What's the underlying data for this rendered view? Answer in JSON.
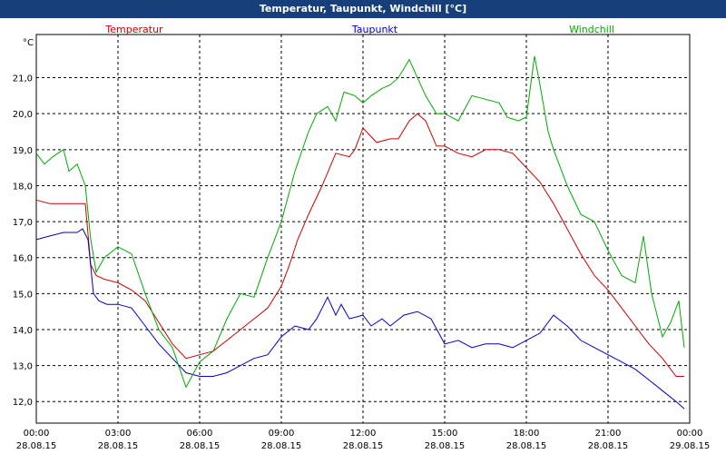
{
  "window": {
    "title": "Temperatur, Taupunkt, Windchill [°C]"
  },
  "chart_data": {
    "type": "line",
    "title": "Temperatur, Taupunkt, Windchill [°C]",
    "ylabel": "°C",
    "ylim": [
      11.4,
      22.2
    ],
    "xlim": [
      0,
      24
    ],
    "yticks": [
      "12,0",
      "13,0",
      "14,0",
      "15,0",
      "16,0",
      "17,0",
      "18,0",
      "19,0",
      "20,0",
      "21,0"
    ],
    "ytick_values": [
      12,
      13,
      14,
      15,
      16,
      17,
      18,
      19,
      20,
      21
    ],
    "xticks": [
      {
        "time": "00:00",
        "date": "28.08.15"
      },
      {
        "time": "03:00",
        "date": "28.08.15"
      },
      {
        "time": "06:00",
        "date": "28.08.15"
      },
      {
        "time": "09:00",
        "date": "28.08.15"
      },
      {
        "time": "12:00",
        "date": "28.08.15"
      },
      {
        "time": "15:00",
        "date": "28.08.15"
      },
      {
        "time": "18:00",
        "date": "28.08.15"
      },
      {
        "time": "21:00",
        "date": "28.08.15"
      },
      {
        "time": "00:00",
        "date": "29.08.15"
      }
    ],
    "grid": true,
    "legend_position": "top",
    "series": [
      {
        "name": "Temperatur",
        "color": "#cc0000",
        "x": [
          0,
          0.5,
          1,
          1.5,
          1.8,
          2,
          2.2,
          2.5,
          3,
          3.5,
          4,
          4.5,
          5,
          5.5,
          6,
          6.5,
          7,
          7.5,
          8,
          8.5,
          9,
          9.3,
          9.6,
          10,
          10.5,
          11,
          11.5,
          11.7,
          12,
          12.5,
          13,
          13.3,
          13.7,
          14,
          14.3,
          14.7,
          15,
          15.5,
          16,
          16.5,
          17,
          17.5,
          18,
          18.5,
          19,
          19.5,
          20,
          20.5,
          21,
          21.5,
          22,
          22.5,
          23,
          23.5,
          23.8
        ],
        "y": [
          17.6,
          17.5,
          17.5,
          17.5,
          17.5,
          15.8,
          15.5,
          15.4,
          15.3,
          15.1,
          14.8,
          14.2,
          13.6,
          13.2,
          13.3,
          13.4,
          13.7,
          14.0,
          14.3,
          14.6,
          15.2,
          15.8,
          16.5,
          17.2,
          18.0,
          18.9,
          18.8,
          19.0,
          19.6,
          19.2,
          19.3,
          19.3,
          19.8,
          20.0,
          19.8,
          19.1,
          19.1,
          18.9,
          18.8,
          19.0,
          19.0,
          18.9,
          18.5,
          18.1,
          17.5,
          16.8,
          16.1,
          15.5,
          15.1,
          14.6,
          14.1,
          13.6,
          13.2,
          12.7,
          12.7
        ]
      },
      {
        "name": "Taupunkt",
        "color": "#0000cc",
        "x": [
          0,
          0.5,
          1,
          1.5,
          1.7,
          1.9,
          2.1,
          2.3,
          2.6,
          3,
          3.5,
          4,
          4.5,
          5,
          5.5,
          6,
          6.5,
          7,
          7.5,
          8,
          8.5,
          9,
          9.5,
          10,
          10.3,
          10.7,
          11,
          11.2,
          11.5,
          12,
          12.3,
          12.7,
          13,
          13.5,
          14,
          14.5,
          15,
          15.5,
          16,
          16.5,
          17,
          17.5,
          18,
          18.5,
          19,
          19.5,
          20,
          20.5,
          21,
          21.5,
          22,
          22.5,
          23,
          23.5,
          23.8
        ],
        "y": [
          16.5,
          16.6,
          16.7,
          16.7,
          16.8,
          16.5,
          15.0,
          14.8,
          14.7,
          14.7,
          14.6,
          14.1,
          13.6,
          13.2,
          12.8,
          12.7,
          12.7,
          12.8,
          13.0,
          13.2,
          13.3,
          13.8,
          14.1,
          14.0,
          14.3,
          14.9,
          14.4,
          14.7,
          14.3,
          14.4,
          14.1,
          14.3,
          14.1,
          14.4,
          14.5,
          14.3,
          13.6,
          13.7,
          13.5,
          13.6,
          13.6,
          13.5,
          13.7,
          13.9,
          14.4,
          14.1,
          13.7,
          13.5,
          13.3,
          13.1,
          12.9,
          12.6,
          12.3,
          12.0,
          11.8
        ]
      },
      {
        "name": "Windchill",
        "color": "#00aa00",
        "x": [
          0,
          0.3,
          0.6,
          1,
          1.2,
          1.5,
          1.8,
          2,
          2.2,
          2.5,
          3,
          3.5,
          4,
          4.5,
          5,
          5.5,
          6,
          6.5,
          7,
          7.5,
          8,
          8.5,
          9,
          9.5,
          10,
          10.3,
          10.7,
          11,
          11.3,
          11.7,
          12,
          12.3,
          12.7,
          13,
          13.3,
          13.7,
          14,
          14.3,
          14.7,
          15,
          15.5,
          16,
          16.5,
          17,
          17.3,
          17.7,
          18,
          18.3,
          18.5,
          18.8,
          19,
          19.5,
          20,
          20.5,
          21,
          21.5,
          22,
          22.3,
          22.6,
          23,
          23.3,
          23.6,
          23.8
        ],
        "y": [
          18.9,
          18.6,
          18.8,
          19.0,
          18.4,
          18.6,
          18.0,
          16.5,
          15.6,
          16.0,
          16.3,
          16.1,
          15.0,
          14.0,
          13.5,
          12.4,
          13.1,
          13.4,
          14.3,
          15.0,
          14.9,
          16.0,
          17.0,
          18.4,
          19.5,
          20.0,
          20.2,
          19.8,
          20.6,
          20.5,
          20.3,
          20.5,
          20.7,
          20.8,
          21.0,
          21.5,
          21.0,
          20.5,
          20.0,
          20.0,
          19.8,
          20.5,
          20.4,
          20.3,
          19.9,
          19.8,
          19.9,
          21.6,
          20.8,
          19.5,
          19.0,
          18.0,
          17.2,
          17.0,
          16.2,
          15.5,
          15.3,
          16.6,
          15.0,
          13.8,
          14.2,
          14.8,
          13.5
        ]
      }
    ]
  }
}
